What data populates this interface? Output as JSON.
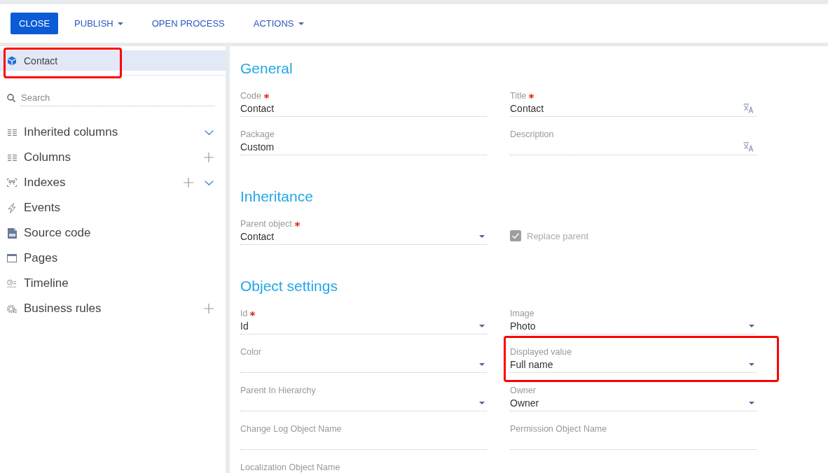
{
  "toolbar": {
    "buttons": [
      {
        "label": "CLOSE",
        "kind": "primary"
      },
      {
        "label": "PUBLISH",
        "kind": "menu"
      },
      {
        "label": "OPEN PROCESS",
        "kind": "plain"
      },
      {
        "label": "ACTIONS",
        "kind": "menu"
      }
    ]
  },
  "sidebar": {
    "root": {
      "label": "Contact",
      "selected": true,
      "highlighted": true
    },
    "search": {
      "placeholder": "Search"
    },
    "items": [
      {
        "label": "Inherited columns",
        "addable": false,
        "expandable": true
      },
      {
        "label": "Columns",
        "addable": true,
        "expandable": false
      },
      {
        "label": "Indexes",
        "addable": true,
        "expandable": true
      },
      {
        "label": "Events",
        "addable": false,
        "expandable": false
      },
      {
        "label": "Source code",
        "addable": false,
        "expandable": false
      },
      {
        "label": "Pages",
        "addable": false,
        "expandable": false
      },
      {
        "label": "Timeline",
        "addable": false,
        "expandable": false
      },
      {
        "label": "Business rules",
        "addable": true,
        "expandable": false
      }
    ]
  },
  "sections": [
    {
      "title": "General",
      "fields": [
        {
          "kind": "text",
          "label": "Code",
          "required": true,
          "highlighted": false,
          "value": "Contact"
        },
        {
          "kind": "localizable",
          "label": "Title",
          "required": true,
          "highlighted": false,
          "value": "Contact"
        },
        {
          "kind": "text",
          "label": "Package",
          "required": false,
          "highlighted": false,
          "value": "Custom"
        },
        {
          "kind": "localizable",
          "label": "Description",
          "required": false,
          "highlighted": false
        }
      ]
    },
    {
      "title": "Inheritance",
      "fields": [
        {
          "kind": "lookup",
          "label": "Parent object",
          "required": true,
          "highlighted": false,
          "value": "Contact"
        },
        {
          "kind": "checkbox",
          "label": "Replace parent",
          "required": false,
          "highlighted": false,
          "checked": true,
          "disabled": true
        }
      ]
    },
    {
      "title": "Object settings",
      "fields": [
        {
          "kind": "lookup",
          "label": "Id",
          "required": true,
          "highlighted": false,
          "value": "Id"
        },
        {
          "kind": "lookup",
          "label": "Image",
          "required": false,
          "highlighted": false,
          "value": "Photo"
        },
        {
          "kind": "lookup",
          "label": "Color",
          "required": false,
          "highlighted": false
        },
        {
          "kind": "lookup",
          "label": "Displayed value",
          "required": false,
          "highlighted": true,
          "value": "Full name"
        },
        {
          "kind": "lookup",
          "label": "Parent In Hierarchy",
          "required": false,
          "highlighted": false
        },
        {
          "kind": "lookup",
          "label": "Owner",
          "required": false,
          "highlighted": false,
          "value": "Owner"
        },
        {
          "kind": "text",
          "label": "Change Log Object Name",
          "required": false,
          "highlighted": false
        },
        {
          "kind": "text",
          "label": "Permission Object Name",
          "required": false,
          "highlighted": false
        },
        {
          "kind": "text",
          "label": "Localization Object Name",
          "required": false,
          "highlighted": false
        }
      ]
    }
  ]
}
